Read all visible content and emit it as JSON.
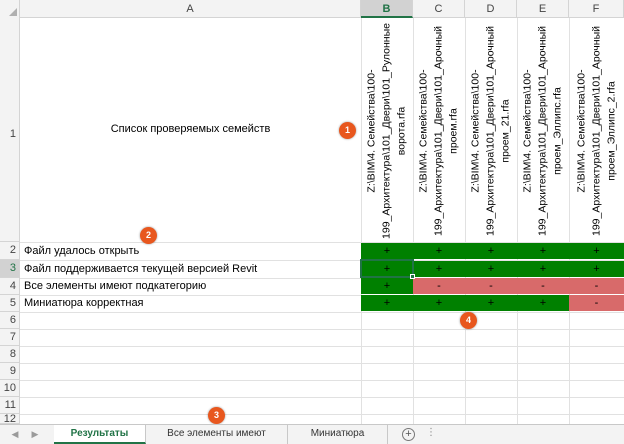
{
  "columns": [
    {
      "label": "A",
      "selected": false
    },
    {
      "label": "B",
      "selected": true
    },
    {
      "label": "C",
      "selected": false
    },
    {
      "label": "D",
      "selected": false
    },
    {
      "label": "E",
      "selected": false
    },
    {
      "label": "F",
      "selected": false
    }
  ],
  "rows": [
    "1",
    "2",
    "3",
    "4",
    "5",
    "6",
    "7",
    "8",
    "9",
    "10",
    "11",
    "12"
  ],
  "list_title": "Список проверяемых семейств",
  "family_paths": [
    "Z:\\BIM\\4. Семейства\\100-199_Архитектура\\101_Двери\\101_Рулонные ворота.rfa",
    "Z:\\BIM\\4. Семейства\\100-199_Архитектура\\101_Двери\\101_Арочный проем.rfa",
    "Z:\\BIM\\4. Семейства\\100-199_Архитектура\\101_Двери\\101_Арочный проем_21.rfa",
    "Z:\\BIM\\4. Семейства\\100-199_Архитектура\\101_Двери\\101_Арочный проем_Эллипс.rfa",
    "Z:\\BIM\\4. Семейства\\100-199_Архитектура\\101_Двери\\101_Арочный проем_Эллипс_2.rfa"
  ],
  "checks": [
    {
      "label": "Файл удалось открыть",
      "results": [
        "+",
        "+",
        "+",
        "+",
        "+"
      ]
    },
    {
      "label": "Файл поддерживается текущей версией Revit",
      "results": [
        "+",
        "+",
        "+",
        "+",
        "+"
      ]
    },
    {
      "label": "Все элементы имеют подкатегорию",
      "results": [
        "+",
        "-",
        "-",
        "-",
        "-"
      ]
    },
    {
      "label": "Миниатюра корректная",
      "results": [
        "+",
        "+",
        "+",
        "+",
        "-"
      ]
    }
  ],
  "markers": [
    "1",
    "2",
    "3",
    "4"
  ],
  "sheet_tabs": [
    {
      "label": "Результаты проверок",
      "active": true
    },
    {
      "label": "Все элементы имеют подкатегорию",
      "active": false
    },
    {
      "label": "Миниатюра корректная",
      "active": false
    }
  ],
  "add_sheet_symbol": "+",
  "overflow_dots": "⋮",
  "colors": {
    "pass": "#008000",
    "fail": "#d86a6a",
    "accent": "#217346",
    "marker": "#e8571e"
  }
}
